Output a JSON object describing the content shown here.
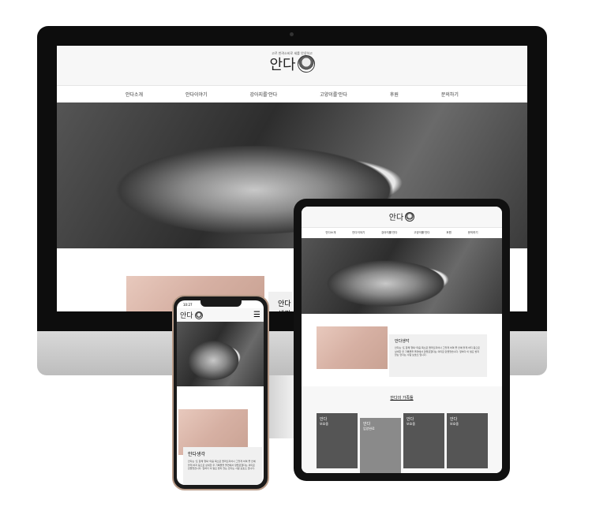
{
  "site": {
    "logo": "안다",
    "tagline": "고르 반려소비로 세를 안녕하고",
    "nav": [
      "안다소개",
      "안다이야기",
      "강아지를'안다",
      "고양이를'안다",
      "후원",
      "문의하기"
    ]
  },
  "about": {
    "title": "안다생각",
    "body": "안다는 '또 함께 행복' 마음 목소로 들려오지어나 그렇게 하며 좋 안에 맡게 하지 등으로 상세한 우 기록물을 돌연에서 양들로했다는 의미로 만들었습니다. 앞하다 이 필요 받지 않는 안다는 사람 보호소 입니다."
  },
  "family": {
    "title": "안다의 가족들",
    "cards": [
      {
        "name": "안다",
        "sub": "보호중"
      },
      {
        "name": "안다",
        "sub": "입양완료"
      },
      {
        "name": "안다",
        "sub": "보호중"
      },
      {
        "name": "안다",
        "sub": "보호중"
      }
    ]
  },
  "phone": {
    "time": "10:27"
  }
}
